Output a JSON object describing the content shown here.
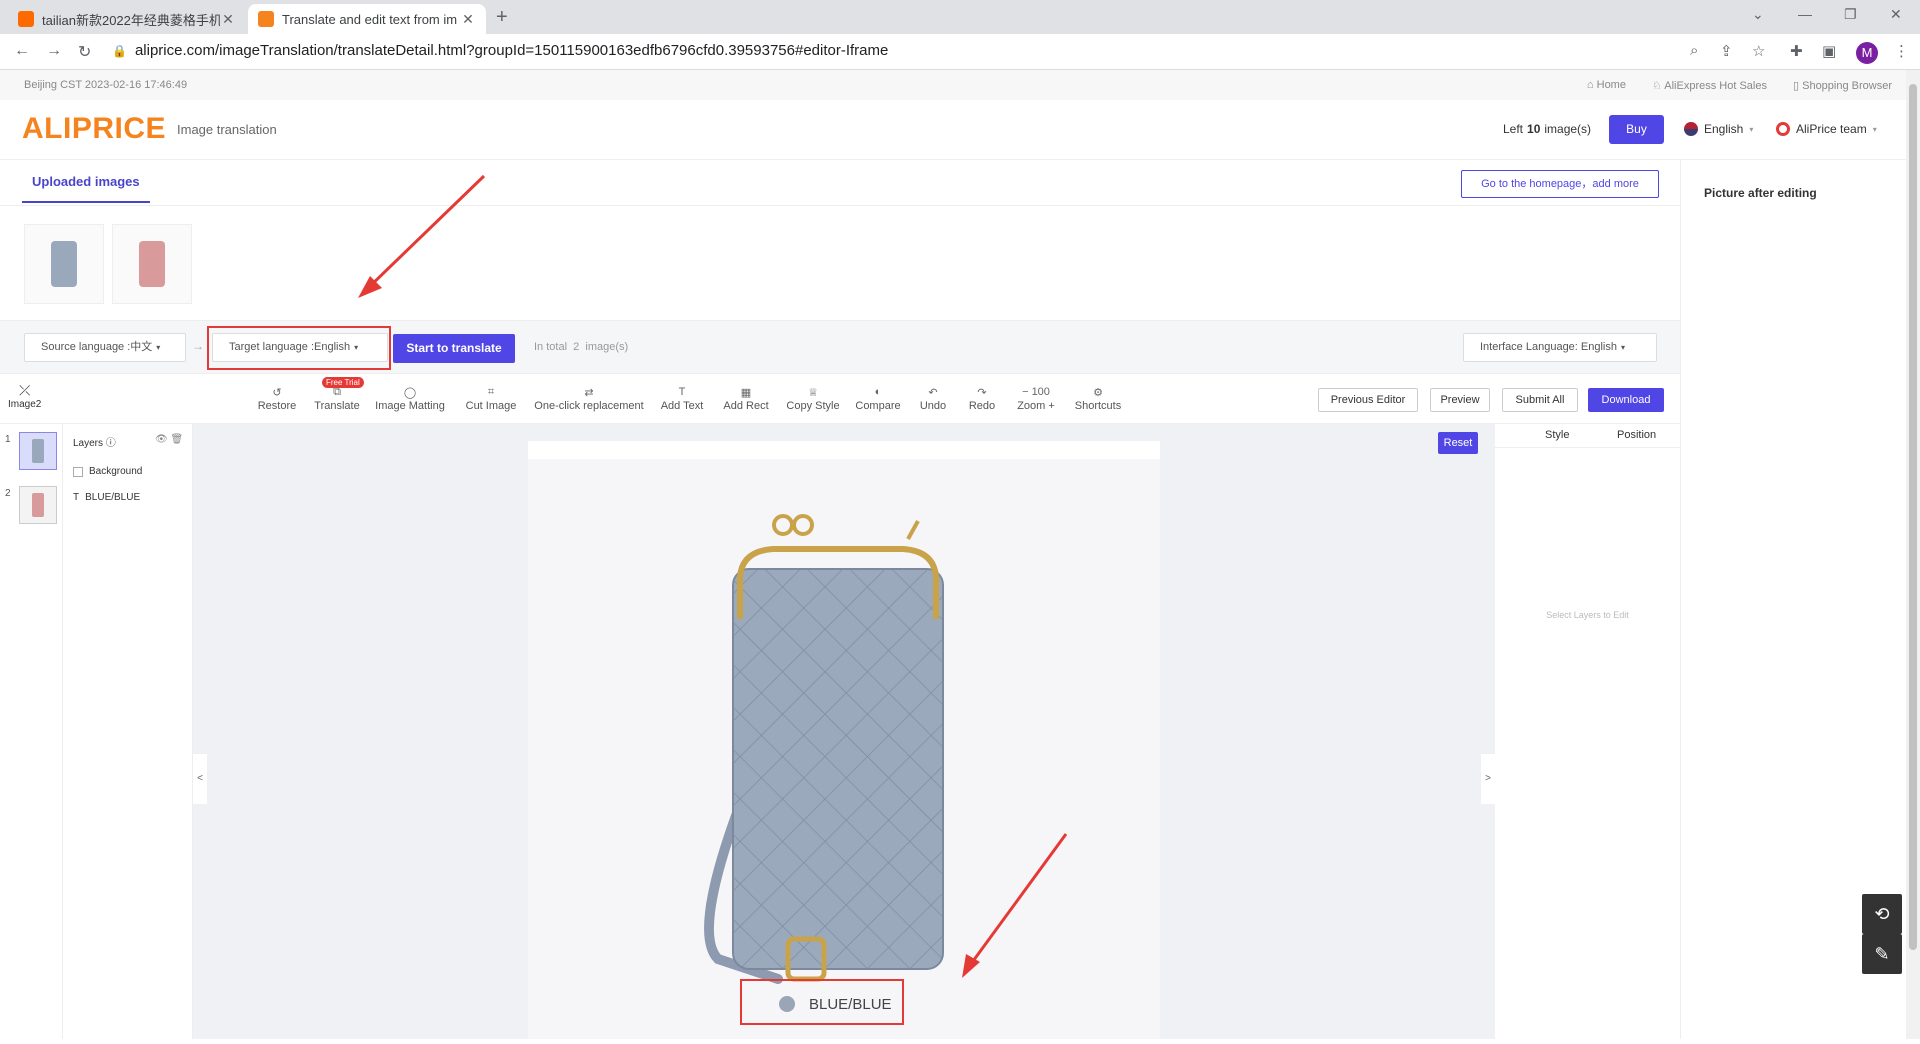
{
  "browser": {
    "tabs": [
      {
        "title": "tailian新款2022年经典菱格手机",
        "active": false
      },
      {
        "title": "Translate and edit text from im",
        "active": true
      }
    ],
    "url": "aliprice.com/imageTranslation/translateDetail.html?groupId=150115900163edfb6796cfd0.39593756#editor-Iframe",
    "profile_initial": "M"
  },
  "infobar": {
    "time": "Beijing CST  2023-02-16 17:46:49",
    "links": [
      "Home",
      "AliExpress Hot Sales",
      "Shopping Browser"
    ]
  },
  "header": {
    "logo": "ALIPRICE",
    "subtitle": "Image translation",
    "left_prefix": "Left",
    "left_count": "10",
    "left_suffix": "image(s)",
    "buy": "Buy",
    "language": "English",
    "team": "AliPrice team"
  },
  "uploaded": {
    "tab": "Uploaded images",
    "home_button": "Go to the homepage，add more",
    "right_title": "Picture after editing"
  },
  "langbar": {
    "source": "Source language :中文",
    "target": "Target language :English",
    "start": "Start to translate",
    "total_prefix": "In total",
    "total_count": "2",
    "total_suffix": "image(s)",
    "interface": "Interface Language: English"
  },
  "toolbar": {
    "collapse_label": "Image2",
    "tools": [
      "Restore",
      "Translate",
      "Image Matting",
      "Cut Image",
      "One-click replacement",
      "Add Text",
      "Add Rect",
      "Copy Style",
      "Compare",
      "Undo",
      "Redo"
    ],
    "free_trial": "Free Trial",
    "zoom_value": "100",
    "zoom_label": "Zoom",
    "shortcuts": "Shortcuts",
    "previous_editor": "Previous Editor",
    "preview": "Preview",
    "submit_all": "Submit All",
    "download": "Download"
  },
  "pages": [
    "1",
    "2"
  ],
  "layers": {
    "title": "Layers",
    "items": [
      "Background",
      "BLUE/BLUE"
    ]
  },
  "canvas": {
    "reset": "Reset",
    "caption": "BLUE/BLUE",
    "swatch_color": "#9aa5b8"
  },
  "rightpanel": {
    "tabs": [
      "Style",
      "Position"
    ],
    "hint": "Select Layers to Edit"
  },
  "colors": {
    "accent": "#5046e5",
    "brand": "#f5841f",
    "annotation": "#e53935",
    "bag_blue": "#9aa8bb",
    "bag_pink": "#d89a9a"
  }
}
